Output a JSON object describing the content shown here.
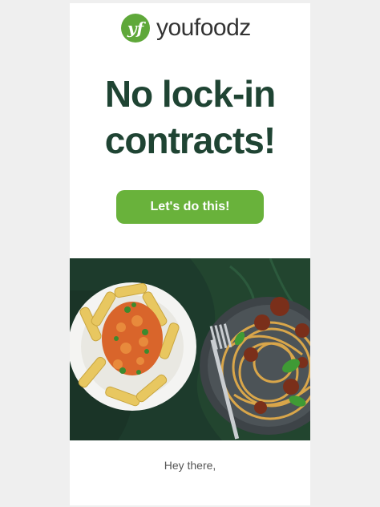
{
  "brand": {
    "name": "youfoodz",
    "mark": "yf",
    "color": "#5fa83a"
  },
  "headline": {
    "line1": "No lock-in",
    "line2": "contracts!",
    "color": "#1f4433"
  },
  "cta": {
    "label": "Let's do this!",
    "color": "#69b23b"
  },
  "hero": {
    "left_dish": "pasta-dish-image",
    "right_dish": "spaghetti-bolognese-image"
  },
  "greeting": "Hey there,"
}
